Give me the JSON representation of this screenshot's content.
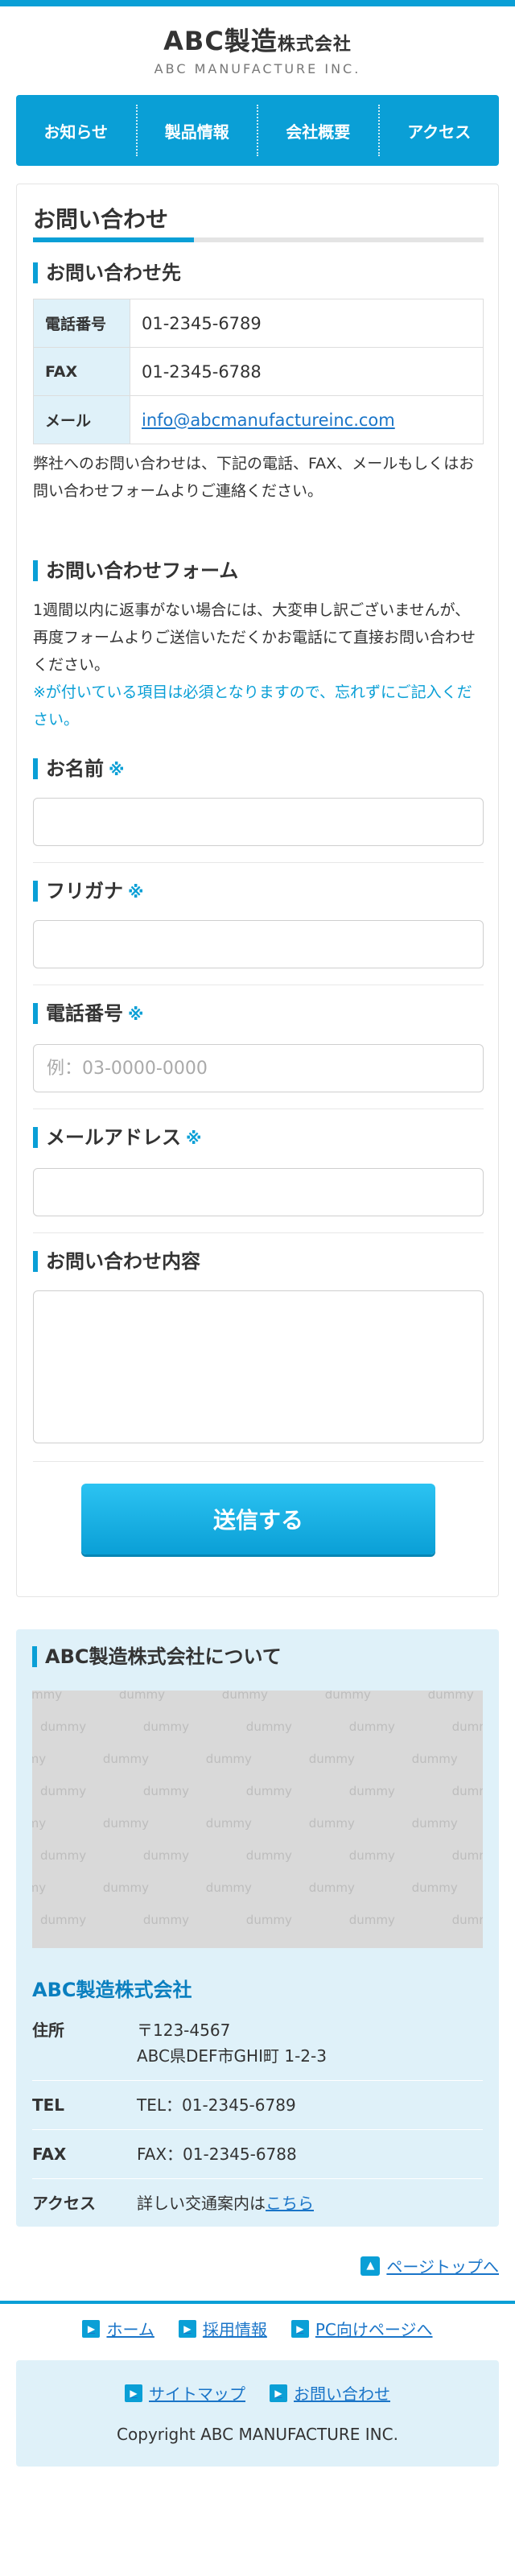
{
  "header": {
    "logo_name": "ABC製造",
    "logo_kk": "株式会社",
    "logo_en": "ABC MANUFACTURE INC."
  },
  "nav": [
    "お知らせ",
    "製品情報",
    "会社概要",
    "アクセス"
  ],
  "page": {
    "title": "お問い合わせ",
    "contact_heading": "お問い合わせ先",
    "contact_rows": [
      {
        "label": "電話番号",
        "value": "01-2345-6789"
      },
      {
        "label": "FAX",
        "value": "01-2345-6788"
      },
      {
        "label": "メール",
        "value": "info@abcmanufactureinc.com"
      }
    ],
    "contact_note": "弊社へのお問い合わせは、下記の電話、FAX、メールもしくはお問い合わせフォームよりご連絡ください。",
    "form_heading": "お問い合わせフォーム",
    "form_note": "1週間以内に返事がない場合には、大変申し訳ございませんが、再度フォームよりご送信いただくかお電話にて直接お問い合わせください。",
    "form_required_note": "※が付いている項目は必須となりますので、忘れずにご記入ください。",
    "required_mark": "※",
    "fields": {
      "name_label": "お名前",
      "kana_label": "フリガナ",
      "phone_label": "電話番号",
      "phone_placeholder": "例：03-0000-0000",
      "email_label": "メールアドレス",
      "message_label": "お問い合わせ内容"
    },
    "submit_label": "送信する"
  },
  "about": {
    "heading": "ABC製造株式会社について",
    "image_text": "dummy",
    "company_name": "ABC製造株式会社",
    "rows": [
      {
        "label": "住所",
        "line1": "〒123-4567",
        "line2": "ABC県DEF市GHI町 1-2-3"
      },
      {
        "label": "TEL",
        "line1": "TEL：01-2345-6789"
      },
      {
        "label": "FAX",
        "line1": "FAX：01-2345-6788"
      },
      {
        "label": "アクセス",
        "line1": "詳しい交通案内は",
        "link": "こちら"
      }
    ]
  },
  "footer": {
    "pagetop": "ページトップへ",
    "links": [
      "ホーム",
      "採用情報",
      "PC向けページへ"
    ],
    "links2": [
      "サイトマップ",
      "お問い合わせ"
    ],
    "copyright": "Copyright ABC MANUFACTURE INC."
  },
  "colors": {
    "accent": "#0a9fd6",
    "light_bg": "#dff1f9",
    "link": "#1a75c8"
  }
}
